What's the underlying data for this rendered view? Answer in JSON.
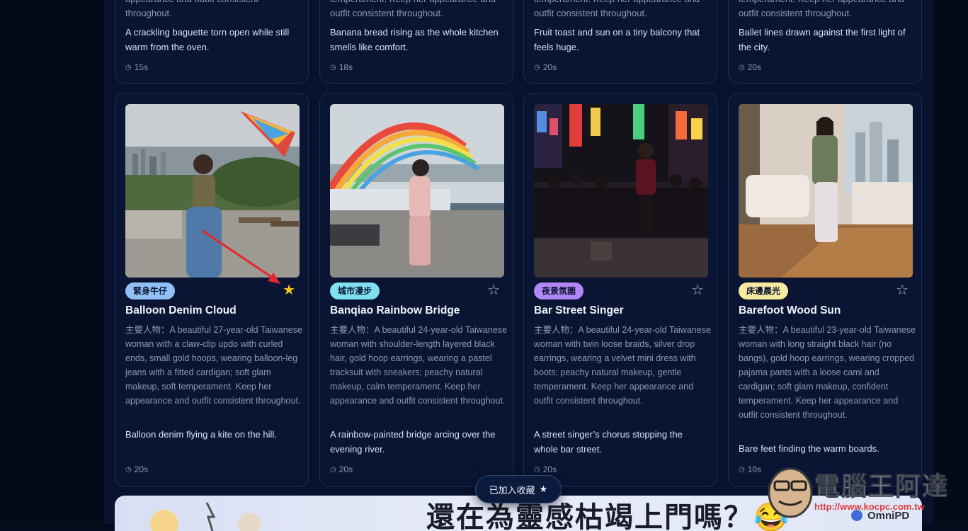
{
  "top_cards": [
    {
      "partial_1": "appearance and outfit consistent",
      "partial_2": "throughout.",
      "scene": "A crackling baguette torn open while still warm from the oven.",
      "duration": "15s"
    },
    {
      "partial_1": "temperament. Keep her appearance and",
      "partial_2": "outfit consistent throughout.",
      "scene": "Banana bread rising as the whole kitchen smells like comfort.",
      "duration": "18s"
    },
    {
      "partial_1": "temperament. Keep her appearance and",
      "partial_2": "outfit consistent throughout.",
      "scene": "Fruit toast and sun on a tiny balcony that feels huge.",
      "duration": "20s"
    },
    {
      "partial_1": "temperament. Keep her appearance and",
      "partial_2": "outfit consistent throughout.",
      "scene": "Ballet lines drawn against the first light of the city.",
      "duration": "20s"
    }
  ],
  "cards": [
    {
      "tag": "緊身牛仔",
      "tag_color": "#8fc1f5",
      "favorited": true,
      "star": "★",
      "title": "Balloon Denim Cloud",
      "description": "主要人物：A beautiful 27-year-old Taiwanese woman with a claw-clip updo with curled ends, small gold hoops, wearing balloon-leg jeans with a fitted cardigan; soft glam makeup, soft temperament. Keep her appearance and outfit consistent throughout.",
      "scene": "Balloon denim flying a kite on the hill.",
      "duration": "20s"
    },
    {
      "tag": "城市漫步",
      "tag_color": "#7fe0f0",
      "favorited": false,
      "star": "☆",
      "title": "Banqiao Rainbow Bridge",
      "description": "主要人物：A beautiful 24-year-old Taiwanese woman with shoulder-length layered black hair, gold hoop earrings, wearing a pastel tracksuit with sneakers; peachy natural makeup, calm temperament. Keep her appearance and outfit consistent throughout.",
      "scene": "A rainbow-painted bridge arcing over the evening river.",
      "duration": "20s"
    },
    {
      "tag": "夜景氛圍",
      "tag_color": "#b087f5",
      "favorited": false,
      "star": "☆",
      "title": "Bar Street Singer",
      "description": "主要人物：A beautiful 24-year-old Taiwanese woman with twin loose braids, silver drop earrings, wearing a velvet mini dress with boots; peachy natural makeup, gentle temperament. Keep her appearance and outfit consistent throughout.",
      "scene": "A street singer’s chorus stopping the whole bar street.",
      "duration": "20s"
    },
    {
      "tag": "床邊晨光",
      "tag_color": "#f8e9a1",
      "favorited": false,
      "star": "☆",
      "title": "Barefoot Wood Sun",
      "description": "主要人物：A beautiful 23-year-old Taiwanese woman with long straight black hair (no bangs), gold hoop earrings, wearing cropped pajama pants with a loose cami and cardigan; soft glam makeup, confident temperament. Keep her appearance and outfit consistent throughout.",
      "scene": "Bare feet finding the warm boards.",
      "duration": "10s"
    }
  ],
  "toast": {
    "label": "已加入收藏",
    "icon": "★"
  },
  "banner": {
    "headline": "還在為靈感枯竭上門嗎？😂"
  },
  "watermark": {
    "brand": "電腦王阿達",
    "url": "http://www.kocpc.com.tw",
    "partner": "OmniPD"
  },
  "clock_icon": "◷"
}
